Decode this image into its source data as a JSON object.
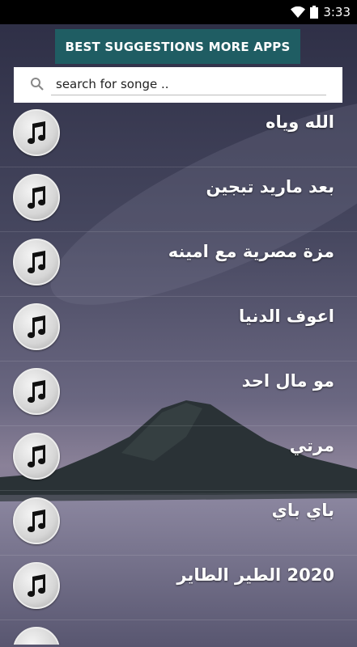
{
  "status_bar": {
    "time": "3:33"
  },
  "banner": {
    "label": "BEST SUGGESTIONS MORE APPS"
  },
  "search": {
    "placeholder": "search for songe .."
  },
  "songs": [
    {
      "title": "الله وياه"
    },
    {
      "title": "بعد ماريد تبجين"
    },
    {
      "title": "مزة مصرية مع امينه"
    },
    {
      "title": "اعوف الدنيا"
    },
    {
      "title": "مو مال احد"
    },
    {
      "title": "مرتي"
    },
    {
      "title": "باي باي"
    },
    {
      "title": "2020  الطير الطاير"
    }
  ],
  "colors": {
    "banner_bg": "#1f5d63",
    "status_bg": "#000000"
  },
  "icons": {
    "song": "music-note-icon",
    "search": "search-icon",
    "wifi": "wifi-icon",
    "battery": "battery-icon"
  }
}
